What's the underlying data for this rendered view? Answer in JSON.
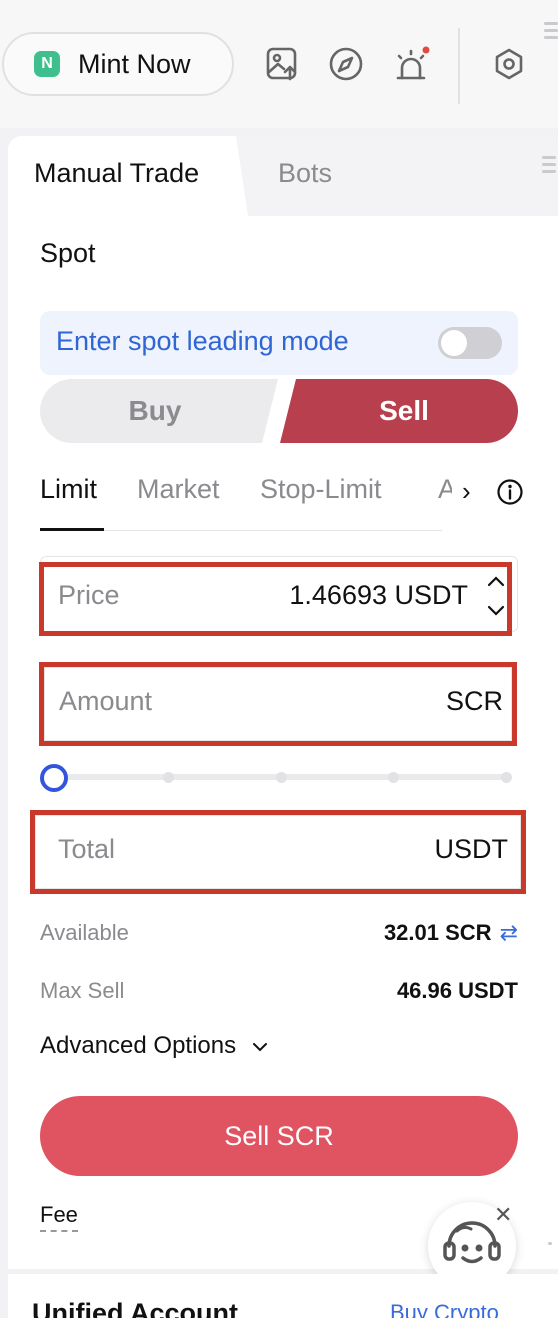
{
  "topbar": {
    "mint_label": "Mint Now",
    "mint_logo_letter": "N",
    "icons": [
      "upload-image-icon",
      "compass-icon",
      "alarm-icon",
      "settings-hex-icon"
    ]
  },
  "tabs": {
    "active": "Manual Trade",
    "inactive": "Bots"
  },
  "section_title": "Spot",
  "lead_mode": {
    "label": "Enter spot leading mode",
    "enabled": false
  },
  "side": {
    "buy": "Buy",
    "sell": "Sell",
    "selected": "Sell"
  },
  "order_types": [
    "Limit",
    "Market",
    "Stop-Limit",
    "A"
  ],
  "order_selected": "Limit",
  "fields": {
    "price": {
      "label": "Price",
      "value": "1.46693 USDT"
    },
    "amount": {
      "label": "Amount",
      "unit": "SCR"
    },
    "total": {
      "label": "Total",
      "unit": "USDT"
    }
  },
  "slider": {
    "value_percent": 0
  },
  "available": {
    "label": "Available",
    "value": "32.01 SCR"
  },
  "max_sell": {
    "label": "Max Sell",
    "value": "46.96 USDT"
  },
  "advanced": "Advanced Options",
  "cta": "Sell SCR",
  "fee": "Fee",
  "bottom": {
    "title": "Unified Account",
    "link": "Buy Crypto"
  },
  "colors": {
    "sell": "#b83f4d",
    "cta": "#e05361",
    "accent": "#2f66d4",
    "highlight": "#c8392c"
  }
}
